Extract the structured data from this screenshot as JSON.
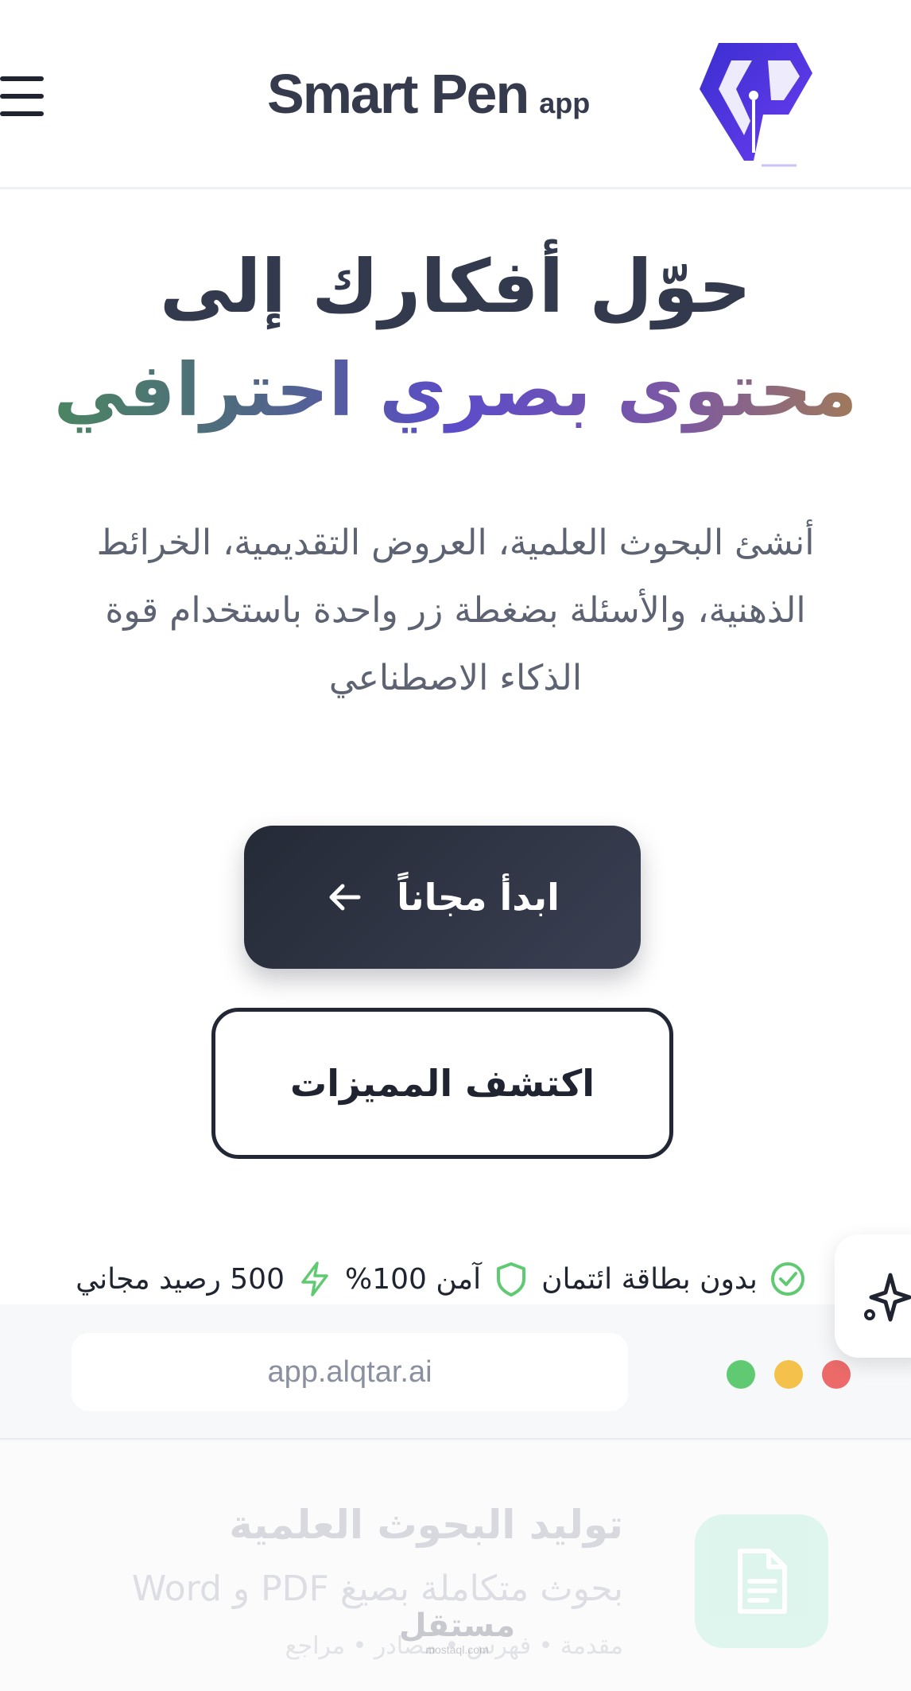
{
  "header": {
    "brand_name": "Smart Pen",
    "brand_suffix": "app"
  },
  "hero": {
    "title_line1": "حوّل أفكارك إلى",
    "title_line2": "محتوى بصري احترافي",
    "subtitle_line1": "أنشئ البحوث العلمية، العروض التقديمية، الخرائط",
    "subtitle_line2": "الذهنية، والأسئلة بضغطة زر واحدة باستخدام قوة",
    "subtitle_line3": "الذكاء الاصطناعي"
  },
  "actions": {
    "primary_label": "ابدأ مجاناً",
    "secondary_label": "اكتشف المميزات"
  },
  "trust": {
    "item1": "بدون بطاقة ائتمان",
    "item2": "آمن 100%",
    "item3": "500 رصيد مجاني"
  },
  "mockup": {
    "url": "app.alqtar.ai",
    "feature_title": "توليد البحوث العلمية",
    "feature_desc": "بحوث متكاملة بصيغ PDF و Word",
    "feature_tags": "مقدمة • فهرس • مصادر • مراجع"
  },
  "watermark": {
    "arabic": "مستقل",
    "latin": "mostaql.com"
  },
  "colors": {
    "dark": "#2f3545",
    "gradient": [
      "#4a8b5c",
      "#5c4cc9",
      "#a8814a"
    ],
    "check_green": "#5fca72"
  },
  "icons": {
    "menu": "hamburger-icon",
    "logo": "sp-logo",
    "arrow": "arrow-left-icon",
    "check": "check-circle-icon",
    "shield": "shield-icon",
    "bolt": "bolt-icon",
    "sparkle": "sparkle-icon",
    "document": "document-icon"
  }
}
